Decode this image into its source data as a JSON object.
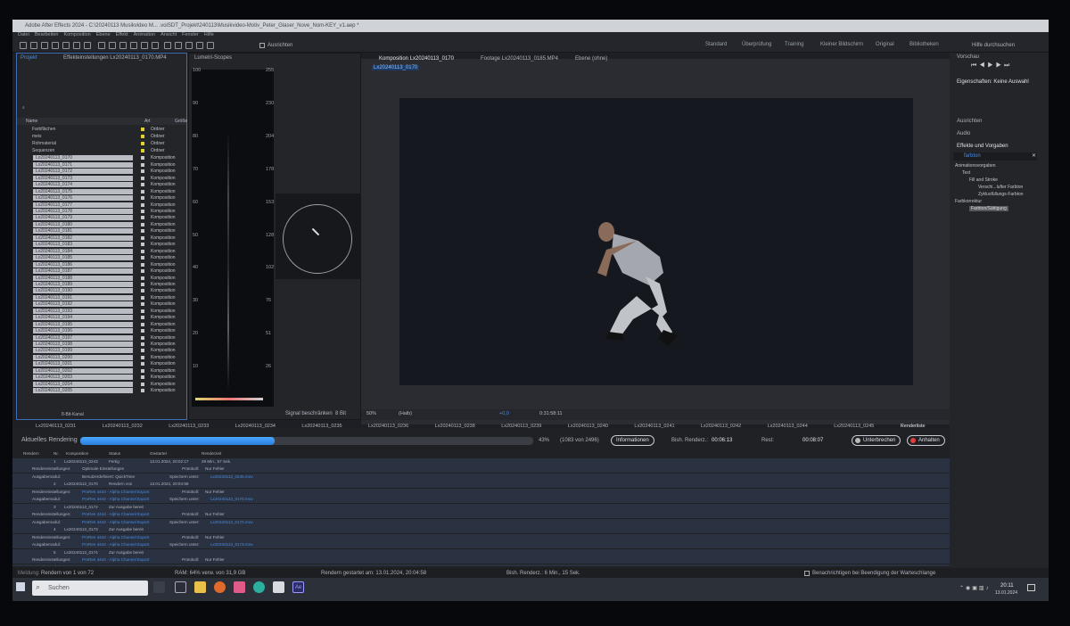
{
  "window": {
    "title": "Adobe After Effects 2024 - C:\\20240113 Musikvideo M... .voiSDT_Projekt\\240113\\Musikvideo-Motiv_Peter_Glaser_Nove_Nom-KEY_v1.aep *"
  },
  "menu": [
    "Datei",
    "Bearbeiten",
    "Komposition",
    "Ebene",
    "Effekt",
    "Animation",
    "Ansicht",
    "Fenster",
    "Hilfe"
  ],
  "toolbar": {
    "align_label": "Ausrichten",
    "search_label": "Hilfe durchsuchen"
  },
  "workspaces": [
    "Standard",
    "Überprüfung",
    "Training",
    "Kleiner Bildschirm",
    "Original",
    "Bibliotheken"
  ],
  "project": {
    "tab": "Projekt",
    "tab2": "Effekteinstellungen Lx20240113_0170.MP4",
    "col_name": "Name",
    "col_type": "Art",
    "col_size": "Größe",
    "folders": [
      {
        "name": "Farbflächen",
        "type": "Ordner"
      },
      {
        "name": "meis",
        "type": "Ordner"
      },
      {
        "name": "Rohmaterial",
        "type": "Ordner"
      },
      {
        "name": "Sequenzen",
        "type": "Ordner"
      }
    ],
    "items": [
      "Lx20240113_0170",
      "Lx20240113_0171",
      "Lx20240113_0172",
      "Lx20240113_0173",
      "Lx20240113_0174",
      "Lx20240113_0175",
      "Lx20240113_0176",
      "Lx20240113_0177",
      "Lx20240113_0178",
      "Lx20240113_0179",
      "Lx20240113_0180",
      "Lx20240113_0181",
      "Lx20240113_0182",
      "Lx20240113_0183",
      "Lx20240113_0184",
      "Lx20240113_0185",
      "Lx20240113_0186",
      "Lx20240113_0187",
      "Lx20240113_0188",
      "Lx20240113_0189",
      "Lx20240113_0190",
      "Lx20240113_0191",
      "Lx20240113_0192",
      "Lx20240113_0193",
      "Lx20240113_0194",
      "Lx20240113_0195",
      "Lx20240113_0196",
      "Lx20240113_0197",
      "Lx20240113_0198",
      "Lx20240113_0199",
      "Lx20240113_0200",
      "Lx20240113_0201",
      "Lx20240113_0202",
      "Lx20240113_0203",
      "Lx20240113_0204",
      "Lx20240113_0205"
    ],
    "item_type": "Komposition",
    "bit_depth": "8-Bit-Kanal"
  },
  "scopes": {
    "tab": "Lumetri-Scopes",
    "left_axis": [
      "100",
      "90",
      "80",
      "70",
      "60",
      "50",
      "40",
      "30",
      "20",
      "10"
    ],
    "right_axis": [
      "255",
      "230",
      "204",
      "178",
      "153",
      "128",
      "102",
      "76",
      "51",
      "26"
    ],
    "clamp_label": "Signal beschränken",
    "bits": "8 Bit"
  },
  "viewer": {
    "tab_comp": "Komposition Lx20240113_0170",
    "tab_footage": "Footage Lx20240113_0185.MP4",
    "tab_layer": "Ebene (ohne)",
    "breadcrumb": "Lx20240113_0170",
    "zoom": "50%",
    "quality": "(Halb)",
    "exposure": "+0,0",
    "timecode": "0:31:58:11"
  },
  "rq_tabs": [
    "Lx20240113_0231",
    "Lx20240113_0232",
    "Lx20240113_0233",
    "Lx20240113_0234",
    "Lx20240113_0235",
    "Lx20240113_0236",
    "Lx20240113_0238",
    "Lx20240113_0239",
    "Lx20240113_0240",
    "Lx20240113_0241",
    "Lx20240113_0242",
    "Lx20240113_0244",
    "Lx20240113_0245",
    "Renderliste"
  ],
  "render": {
    "heading": "Aktuelles Rendering",
    "progress_fraction": 0.43,
    "percent": "43%",
    "frames": "(1083 von 2496)",
    "info": "Informationen",
    "elapsed_label": "Bish. Renderz.:",
    "elapsed": "00:06:13",
    "rest_label": "Rest:",
    "rest": "00:08:07",
    "stop": "Unterbrechen",
    "pause": "Anhalten",
    "cols": [
      "Rendern",
      "Nr.",
      "Komposition",
      "Status",
      "Gestartet",
      "Renderzeit"
    ],
    "first": {
      "nr": "1",
      "comp": "Lx20240113_0243",
      "status": "Fertig",
      "started": "13.01.2024, 20:02:17",
      "time": "29 Min., 57 Sek."
    },
    "settings_label": "Rendereinstellungen:",
    "settings_val": "Optimale Einstellungen",
    "output_label": "Ausgabemodul:",
    "output_val": "Benutzerdefiniert: QuickTime",
    "prores": "ProRes 4444 - Alpha Channel Export",
    "log_label": "Protokoll:",
    "log_val": "Nur Fehler",
    "save_label": "Speichern unter:",
    "rows": [
      {
        "nr": "2",
        "comp": "Lx20240113_0170",
        "status": "Rendern von",
        "started": "13.01.2024, 20:04:58",
        "file": "Lx20240113_0170.mov"
      },
      {
        "nr": "3",
        "comp": "Lx20240113_0172",
        "status": "Zur Ausgabe bereit",
        "file": "Lx20240113_0172.mov"
      },
      {
        "nr": "4",
        "comp": "Lx20240113_0173",
        "status": "Zur Ausgabe bereit",
        "file": "Lx20240113_0173.mov"
      },
      {
        "nr": "5",
        "comp": "Lx20240113_0174",
        "status": "Zur Ausgabe bereit",
        "file": "Lx20240113_0174.mov"
      },
      {
        "nr": "6",
        "comp": "Lx20240113_0175",
        "status": "Zur Ausgabe bereit",
        "file": "Lx20240113_0175.mov"
      }
    ],
    "first_file": "Lx20240113_0245.mov"
  },
  "status": {
    "message_label": "Meldung:",
    "message": "Rendern von 1 von 72",
    "ram": "RAM: 64% verw. von 31,9 GB",
    "started": "Rendern gestartet am: 13.01.2024, 20:04:58",
    "total": "Bish. Renderz.:  6 Min., 15 Sek.",
    "notify": "Benachrichtigen bei Beendigung der Warteschlange"
  },
  "right": {
    "preview": "Vorschau",
    "props": "Eigenschaften: Keine Auswahl",
    "align": "Ausrichten",
    "audio": "Audio",
    "effects": "Effekte und Vorgaben",
    "search": "farbton",
    "tree": [
      "Animationsvorgaben",
      "Text",
      "Fill and Stroke",
      "Verschi...lufter Farbton",
      "Zyklusfüllungs-Farbton",
      "Farbkorrektur",
      "Farbton/Sättigung"
    ]
  },
  "taskbar": {
    "search": "Suchen",
    "time": "20:11",
    "date": "13.01.2024"
  }
}
